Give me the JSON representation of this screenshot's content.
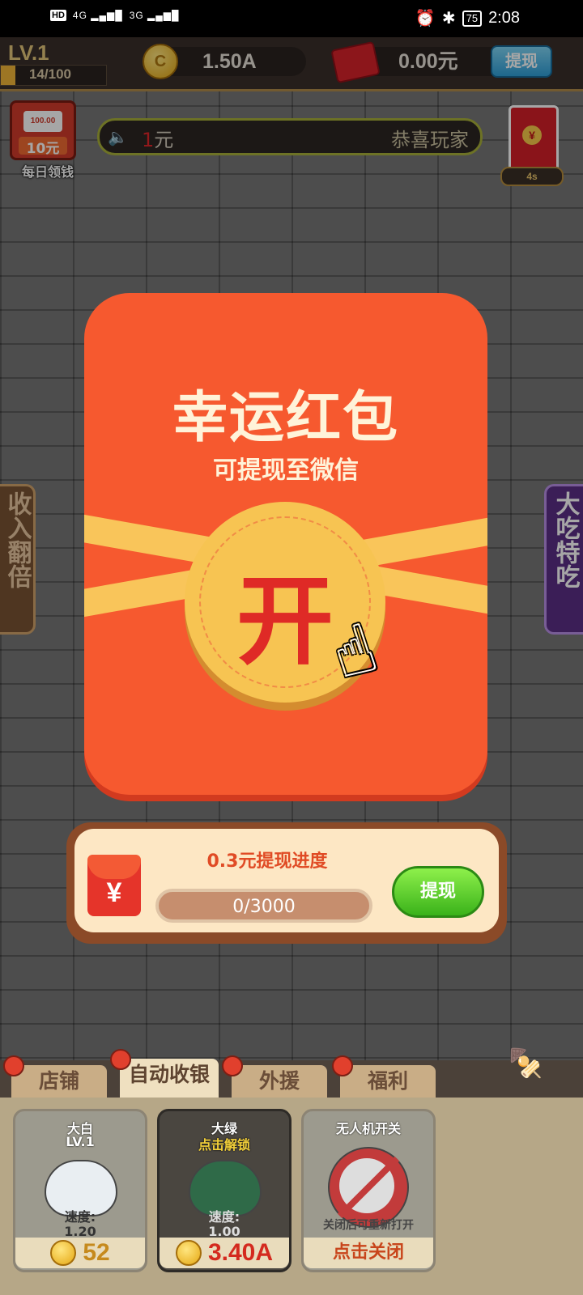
{
  "status_bar": {
    "left": {
      "hd": "HD",
      "sim1": "4G",
      "sim2": "3G"
    },
    "right": {
      "battery": "75",
      "time": "2:08"
    }
  },
  "top_bar": {
    "level": "LV.1",
    "exp": "14/100",
    "exp_progress": 0.14,
    "coins": "1.50A",
    "cash": "0.00元",
    "withdraw_label": "提现"
  },
  "daily_reward": {
    "badge": "100.00",
    "amount": "10元",
    "label": "每日领钱"
  },
  "ticker": {
    "amount_prefix": "1",
    "amount_unit": "元",
    "message": "恭喜玩家"
  },
  "red_packet_timer": "4s",
  "side_tabs": {
    "left": "收入翻倍",
    "right": "大吃特吃"
  },
  "modal": {
    "title": "幸运红包",
    "subtitle": "可提现至微信",
    "open_label": "开"
  },
  "withdraw_progress": {
    "title": "0.3元提现进度",
    "value": "0/3000",
    "progress": 0.0,
    "button": "提现"
  },
  "tabs": [
    {
      "label": "店铺",
      "active": false
    },
    {
      "label": "自动收银",
      "active": true
    },
    {
      "label": "外援",
      "active": false
    },
    {
      "label": "福利",
      "active": false
    }
  ],
  "cards": [
    {
      "name": "大白",
      "sub": "LV.1",
      "speed_label": "速度:",
      "speed": "1.20",
      "price": "52"
    },
    {
      "name": "大绿",
      "sub": "点击解锁",
      "speed_label": "速度:",
      "speed": "1.00",
      "price": "3.40A"
    },
    {
      "name": "无人机开关",
      "note": "关闭后可重新打开",
      "action": "点击关闭"
    }
  ],
  "colors": {
    "modal": "#f6592f",
    "seal": "#f7c452",
    "seal_text": "#df2a26",
    "withdraw_button": "#3ab21a",
    "top_withdraw": "#2f9fd8"
  }
}
